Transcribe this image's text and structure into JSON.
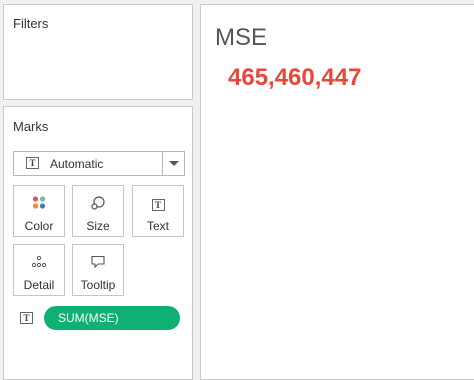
{
  "filters": {
    "title": "Filters"
  },
  "marks": {
    "title": "Marks",
    "mark_type": {
      "selected": "Automatic"
    },
    "buttons": [
      {
        "label": "Color",
        "icon": "color-dots-icon"
      },
      {
        "label": "Size",
        "icon": "size-icon"
      },
      {
        "label": "Text",
        "icon": "text-icon"
      },
      {
        "label": "Detail",
        "icon": "detail-icon"
      },
      {
        "label": "Tooltip",
        "icon": "tooltip-icon"
      }
    ],
    "pill": {
      "label": "SUM(MSE)",
      "color": "#0fb074",
      "icon": "text-icon"
    }
  },
  "viz": {
    "title": "MSE",
    "value": "465,460,447",
    "value_color": "#e8473a"
  }
}
